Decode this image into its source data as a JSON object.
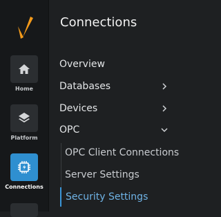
{
  "rail": {
    "items": [
      {
        "label": "Home",
        "icon": "home-icon"
      },
      {
        "label": "Platform",
        "icon": "layers-icon"
      },
      {
        "label": "Connections",
        "icon": "connections-icon"
      }
    ],
    "active": "Connections",
    "accent": "#2f8fd0",
    "logo_color": "#f49a1a"
  },
  "panel": {
    "title": "Connections",
    "items": [
      {
        "label": "Overview"
      },
      {
        "label": "Databases"
      },
      {
        "label": "Devices"
      },
      {
        "label": "OPC"
      }
    ],
    "opc_sub_items": [
      {
        "label": "OPC Client Connections"
      },
      {
        "label": "Server Settings"
      },
      {
        "label": "Security Settings"
      }
    ],
    "active_sub_item": "Security Settings",
    "active_color": "#6fb3e6"
  }
}
